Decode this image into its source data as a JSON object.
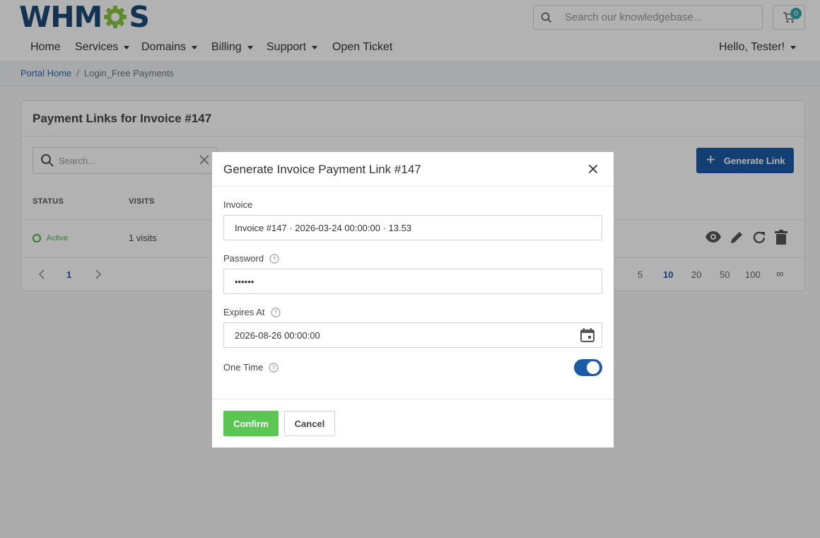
{
  "header": {
    "logo_left": "WHM",
    "logo_right": "S",
    "search_placeholder": "Search our knowledgebase...",
    "cart_count": "0",
    "user_greeting": "Hello, Tester!"
  },
  "nav": {
    "items": [
      {
        "label": "Home"
      },
      {
        "label": "Services"
      },
      {
        "label": "Domains"
      },
      {
        "label": "Billing"
      },
      {
        "label": "Support"
      },
      {
        "label": "Open Ticket"
      }
    ]
  },
  "breadcrumb": {
    "home": "Portal Home",
    "separator": "/",
    "current": "Login_Free Payments"
  },
  "card": {
    "title": "Payment Links for Invoice #147",
    "search_placeholder": "Search...",
    "generate_label": "Generate Link",
    "columns": [
      "STATUS",
      "VISITS"
    ],
    "row": {
      "status": "Active",
      "visits": "1 visits"
    },
    "pager": {
      "current_page": "1",
      "page_sizes": [
        "5",
        "10",
        "20",
        "50",
        "100",
        "∞"
      ],
      "active_size": "10"
    }
  },
  "modal": {
    "title": "Generate Invoice Payment Link #147",
    "invoice_label": "Invoice",
    "invoice_value": "Invoice #147 · 2026-03-24 00:00:00 · 13.53",
    "password_label": "Password",
    "password_value": "••••••",
    "expires_label": "Expires At",
    "expires_value": "2026-08-26 00:00:00",
    "onetime_label": "One Time",
    "onetime_enabled": true,
    "confirm_label": "Confirm",
    "cancel_label": "Cancel"
  },
  "colors": {
    "brand_blue": "#1e5ba7",
    "confirm_green": "#5cc655",
    "active_green": "#4cae4c",
    "gear_green": "#8cc63f"
  }
}
